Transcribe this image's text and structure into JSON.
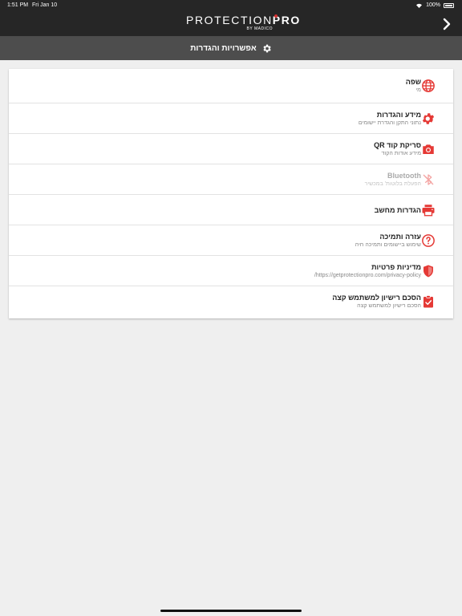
{
  "statusbar": {
    "time": "1:51 PM",
    "date": "Fri Jan 10",
    "battery": "100%"
  },
  "app": {
    "logo_word_1": "PROTECTION",
    "logo_word_2": "PRO",
    "logo_sub": "BY MADICO"
  },
  "icons": {
    "nav_forward": "chevron-right-icon",
    "header": "gear-icon"
  },
  "colors": {
    "accent": "#e53935",
    "navbar": "#262626",
    "subheader": "#4d4d4d",
    "background": "#efefef"
  },
  "header": {
    "title": "אפשרויות והגדרות"
  },
  "menu": {
    "items": [
      {
        "title": "שפה",
        "subtitle": "מי",
        "icon": "globe-icon",
        "enabled": true
      },
      {
        "title": "מידע והגדרות",
        "subtitle": "נתוני התקן והגדרת יישומים",
        "icon": "gear-icon",
        "enabled": true
      },
      {
        "title": "סריקת קוד QR",
        "subtitle": "מידע אודות הקוד",
        "icon": "camera-icon",
        "enabled": true
      },
      {
        "title": "Bluetooth",
        "subtitle": "הפעלת בלוטות' במכשיר",
        "icon": "bluetooth-disabled-icon",
        "enabled": false
      },
      {
        "title": "הגדרות מחשב",
        "subtitle": "",
        "icon": "printer-icon",
        "enabled": true
      },
      {
        "title": "עזרה ותמיכה",
        "subtitle": "שימוש ביישומים ותמיכה חיה",
        "icon": "help-icon",
        "enabled": true
      },
      {
        "title": "מדיניות פרטיות",
        "subtitle": "https://getprotectionpro.com/privacy-policy/",
        "icon": "shield-icon",
        "enabled": true
      },
      {
        "title": "הסכם רישיון למשתמש קצה",
        "subtitle": "הסכם רישיון למשתמש קצה",
        "icon": "clipboard-check-icon",
        "enabled": true
      }
    ]
  }
}
